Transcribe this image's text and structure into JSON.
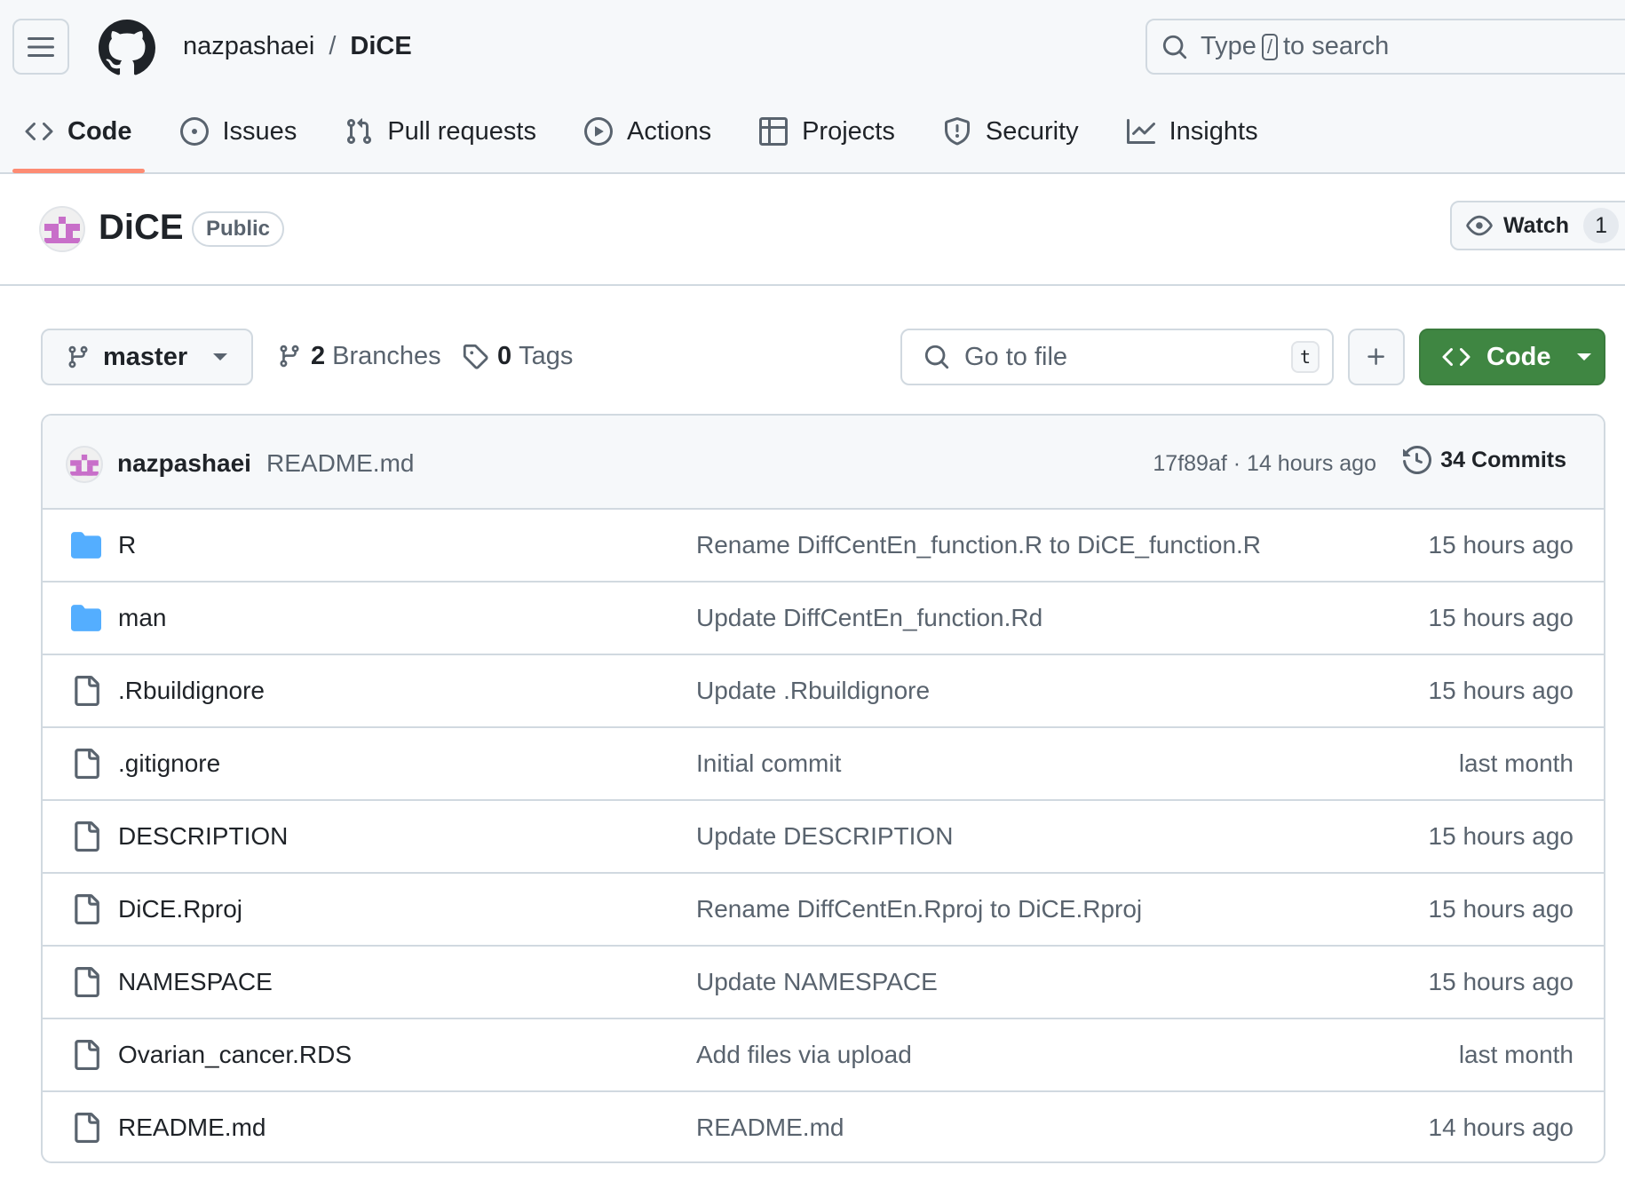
{
  "header": {
    "owner": "nazpashaei",
    "separator": "/",
    "repo": "DiCE",
    "search": {
      "prefix": "Type",
      "key": "/",
      "suffix": "to search"
    }
  },
  "tabs": [
    {
      "label": "Code",
      "icon": "code-icon",
      "active": true
    },
    {
      "label": "Issues",
      "icon": "issue-opened-icon"
    },
    {
      "label": "Pull requests",
      "icon": "git-pull-request-icon"
    },
    {
      "label": "Actions",
      "icon": "play-icon"
    },
    {
      "label": "Projects",
      "icon": "table-icon"
    },
    {
      "label": "Security",
      "icon": "shield-icon"
    },
    {
      "label": "Insights",
      "icon": "graph-icon"
    }
  ],
  "repo": {
    "name": "DiCE",
    "visibility": "Public",
    "watch_label": "Watch",
    "watch_count": "1"
  },
  "toolbar": {
    "branch": "master",
    "branches_count": "2",
    "branches_label": "Branches",
    "tags_count": "0",
    "tags_label": "Tags",
    "goto_placeholder": "Go to file",
    "goto_shortcut": "t",
    "code_label": "Code"
  },
  "latest_commit": {
    "author": "nazpashaei",
    "message": "README.md",
    "sha": "17f89af",
    "separator": "·",
    "time": "14 hours ago",
    "commits_label": "34 Commits"
  },
  "files": [
    {
      "name": "R",
      "type": "dir",
      "message": "Rename DiffCentEn_function.R to DiCE_function.R",
      "date": "15 hours ago"
    },
    {
      "name": "man",
      "type": "dir",
      "message": "Update DiffCentEn_function.Rd",
      "date": "15 hours ago"
    },
    {
      "name": ".Rbuildignore",
      "type": "file",
      "message": "Update .Rbuildignore",
      "date": "15 hours ago"
    },
    {
      "name": ".gitignore",
      "type": "file",
      "message": "Initial commit",
      "date": "last month"
    },
    {
      "name": "DESCRIPTION",
      "type": "file",
      "message": "Update DESCRIPTION",
      "date": "15 hours ago"
    },
    {
      "name": "DiCE.Rproj",
      "type": "file",
      "message": "Rename DiffCentEn.Rproj to DiCE.Rproj",
      "date": "15 hours ago"
    },
    {
      "name": "NAMESPACE",
      "type": "file",
      "message": "Update NAMESPACE",
      "date": "15 hours ago"
    },
    {
      "name": "Ovarian_cancer.RDS",
      "type": "file",
      "message": "Add files via upload",
      "date": "last month"
    },
    {
      "name": "README.md",
      "type": "file",
      "message": "README.md",
      "date": "14 hours ago"
    }
  ],
  "colors": {
    "accent_underline": "#fd8c73",
    "primary_button": "#3f8642",
    "folder": "#54aeff",
    "muted_text": "#59636e",
    "border": "#d1d9e0",
    "avatar": "#c86fc9"
  }
}
